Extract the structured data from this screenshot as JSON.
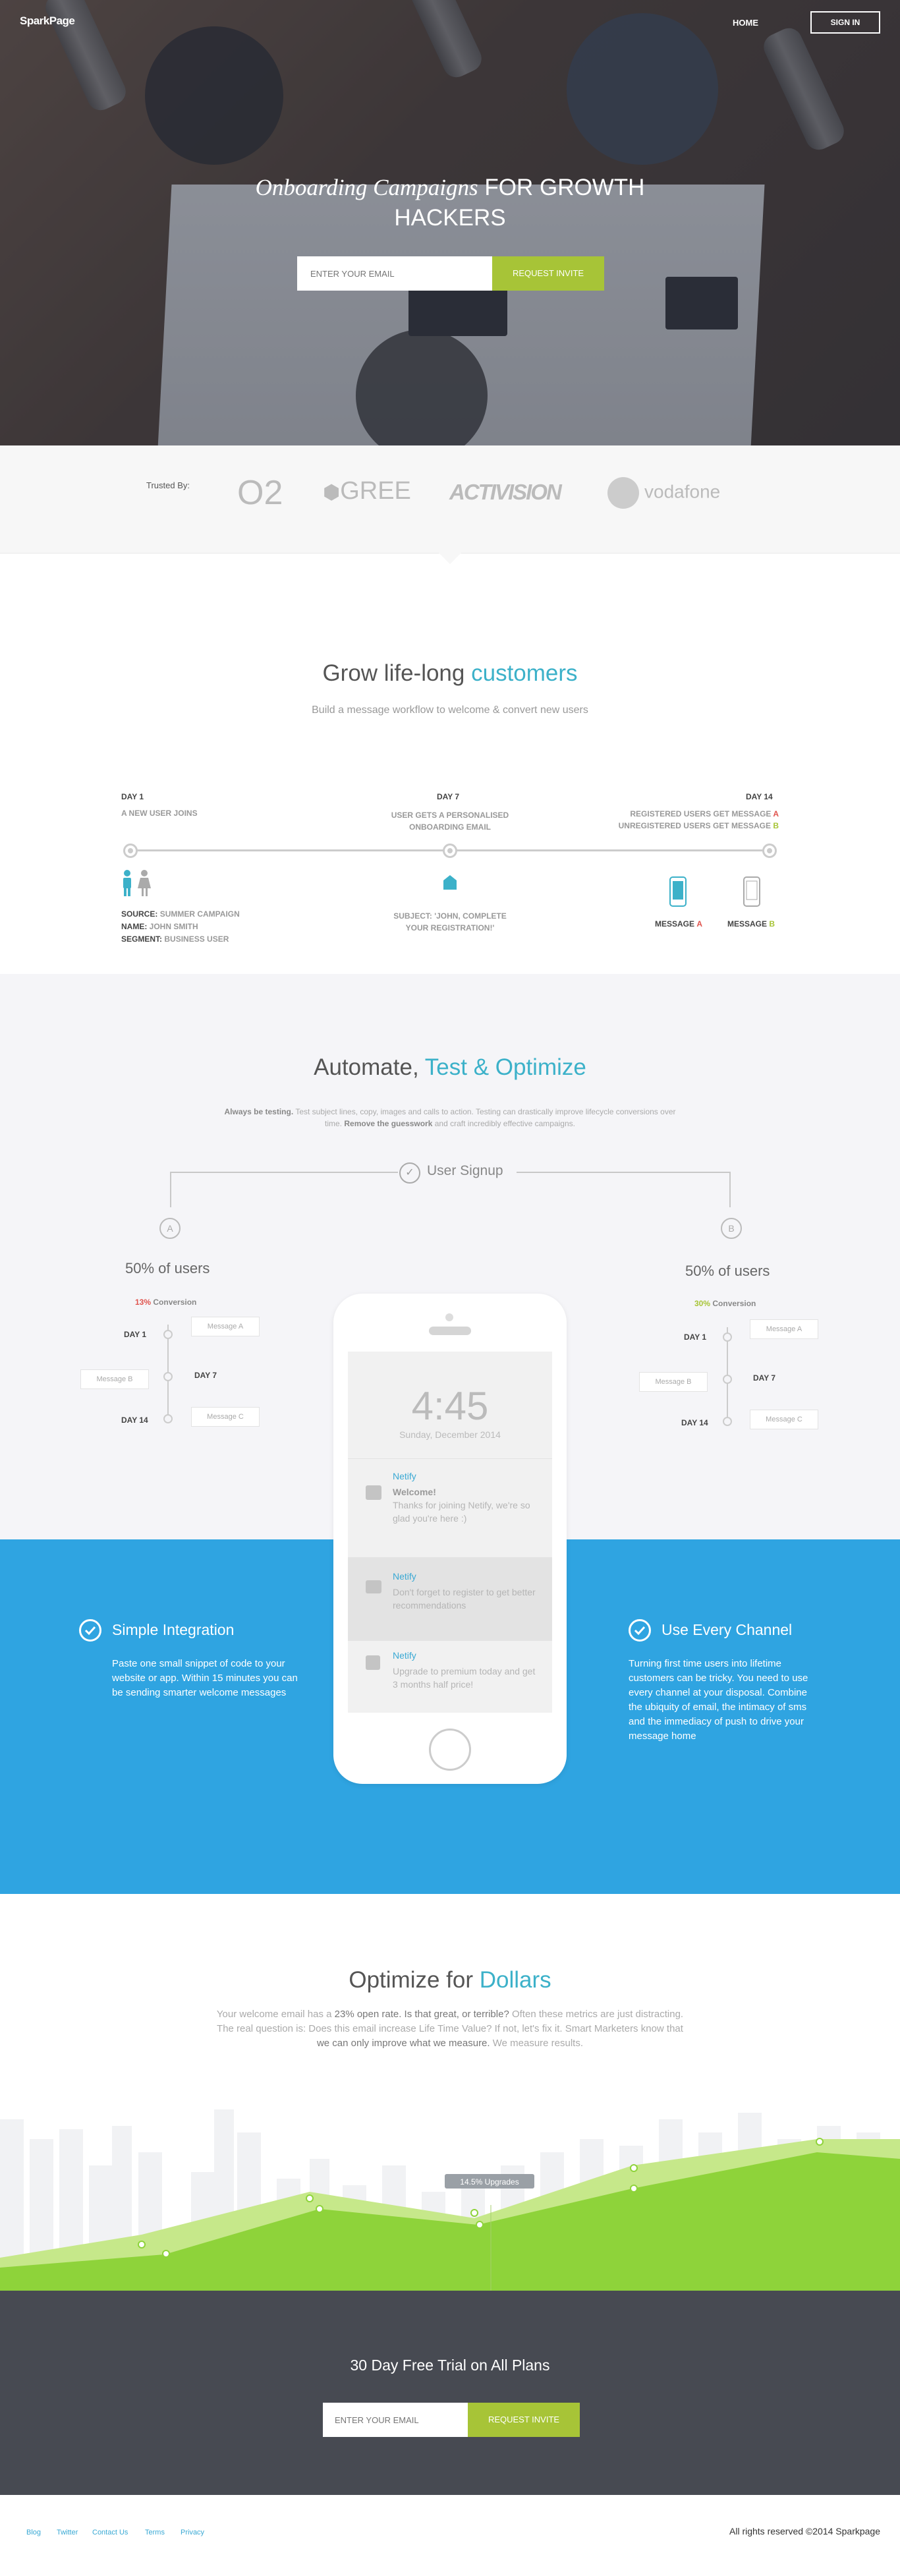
{
  "nav": {
    "logo": "SparkPage",
    "home": "HOME",
    "signin": "SIGN IN"
  },
  "hero": {
    "title_italic": "Onboarding Campaigns",
    "title_rest_1": "FOR GROWTH",
    "title_rest_2": "HACKERS",
    "email_placeholder": "ENTER YOUR EMAIL",
    "button": "REQUEST INVITE"
  },
  "trusted": {
    "label": "Trusted By:",
    "logos": [
      "O2",
      "GREE",
      "ACTIVISION",
      "vodafone"
    ]
  },
  "lifelong": {
    "title_a": "Grow life-long",
    "title_b": "customers",
    "subtitle": "Build a message workflow to welcome & convert new users",
    "day1": "DAY 1",
    "day1_text": "A NEW USER JOINS",
    "day7": "DAY 7",
    "day7_text_1": "USER GETS A PERSONALISED",
    "day7_text_2": "ONBOARDING EMAIL",
    "day14": "DAY 14",
    "day14_text_1a": "REGISTERED USERS GET MESSAGE",
    "day14_text_1b": "A",
    "day14_text_2a": "UNREGISTERED USERS GET MESSAGE",
    "day14_text_2b": "B",
    "source_label": "SOURCE:",
    "source_value": "SUMMER CAMPAIGN",
    "name_label": "NAME:",
    "name_value": "JOHN SMITH",
    "segment_label": "SEGMENT:",
    "segment_value": "BUSINESS USER",
    "subject_1": "SUBJECT: 'JOHN, COMPLETE",
    "subject_2": "YOUR REGISTRATION!'",
    "msg_a_label": "MESSAGE",
    "msg_a_letter": "A",
    "msg_b_label": "MESSAGE",
    "msg_b_letter": "B"
  },
  "automate": {
    "title_a": "Automate,",
    "title_b": "Test & Optimize",
    "desc_bold1": "Always be testing.",
    "desc_1": "Test subject lines, copy, images and calls to action. Testing can drastically improve",
    "desc_2": "lifecycle conversions over time.",
    "desc_bold2": "Remove the guesswork",
    "desc_3": "and craft incredibly effective campaigns.",
    "signup": "User Signup",
    "left": {
      "letter": "A",
      "pct": "50% of users",
      "conv_pct": "13%",
      "conv": "Conversion",
      "day1": "DAY 1",
      "day7": "DAY 7",
      "day14": "DAY 14",
      "m1": "Message A",
      "m2": "Message B",
      "m3": "Message C"
    },
    "right": {
      "letter": "B",
      "pct": "50% of users",
      "conv_pct": "30%",
      "conv": "Conversion",
      "day1": "DAY 1",
      "day7": "DAY 7",
      "day14": "DAY 14",
      "m1": "Message A",
      "m2": "Message B",
      "m3": "Message C"
    }
  },
  "phone": {
    "time": "4:45",
    "date": "Sunday, December 2014",
    "notifs": [
      {
        "app": "Netify",
        "title": "Welcome!",
        "body": "Thanks for joining Netify, we're so glad you're here :)"
      },
      {
        "app": "Netify",
        "title": "",
        "body": "Don't forget to register to get better recommendations"
      },
      {
        "app": "Netify",
        "title": "",
        "body": "Upgrade to premium today and get 3 months half price!"
      }
    ]
  },
  "features": {
    "left_title": "Simple Integration",
    "left_text": "Paste one small snippet of code to your website or app. Within 15 minutes you can be sending smarter welcome messages",
    "right_title": "Use Every Channel",
    "right_text": "Turning first time users into lifetime customers can be tricky. You need to use every channel at your disposal. Combine the ubiquity of email, the intimacy of sms and the immediacy of push to drive your message home"
  },
  "optimize": {
    "title_a": "Optimize for",
    "title_b": "Dollars",
    "t1": "Your welcome email has a",
    "b1": "23% open rate. Is that great, or terrible?",
    "t2": "Often these metrics are just distracting. The real question is: Does this email increase Life Time Value? If not, let's fix it. Smart Marketers know that",
    "b2": "we can only improve what we measure.",
    "t3": "We measure results.",
    "tooltip": "14.5% Upgrades"
  },
  "cta": {
    "title": "30 Day Free Trial on All Plans",
    "placeholder": "ENTER YOUR EMAIL",
    "button": "REQUEST INVITE"
  },
  "footer": {
    "links": [
      "Blog",
      "Twitter",
      "Contact Us",
      "Terms",
      "Privacy"
    ],
    "copyright": "All rights reserved ©2014 Sparkpage"
  },
  "colors": {
    "accent": "#3cb1c9",
    "green": "#a7c437",
    "blue": "#2fa4e1",
    "dark": "#474a52",
    "red": "#e0544e",
    "chart_green": "#8ed33a"
  }
}
